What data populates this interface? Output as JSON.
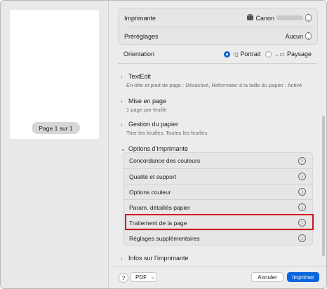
{
  "preview": {
    "page_label": "Page 1 sur 1"
  },
  "top_group": {
    "printer_label": "Imprimante",
    "printer_value": "Canon",
    "presets_label": "Préréglages",
    "presets_value": "Aucun"
  },
  "orientation": {
    "label": "Orientation",
    "portrait_label": "Portrait",
    "landscape_label": "Paysage",
    "selected": "Portrait"
  },
  "sections": [
    {
      "title": "TextEdit",
      "subtitle": "En-tête et pied de page : Désactivé, Reformater à la taille du papier : Activé"
    },
    {
      "title": "Mise en page",
      "subtitle": "1 page par feuille"
    },
    {
      "title": "Gestion du papier",
      "subtitle": "Trier les feuilles, Toutes les feuilles"
    }
  ],
  "printer_options": {
    "title": "Options d’imprimante",
    "items": [
      "Concordance des couleurs",
      "Qualité et support",
      "Options couleur",
      "Param. détaillés papier",
      "Traitement de la page",
      "Réglages supplémentaires"
    ]
  },
  "printer_info": {
    "title": "Infos sur l’imprimante"
  },
  "footer": {
    "help": "?",
    "pdf": "PDF",
    "cancel": "Annuler",
    "print": "Imprimer"
  },
  "colors": {
    "accent": "#0a66dd",
    "highlight": "#d0131a"
  }
}
